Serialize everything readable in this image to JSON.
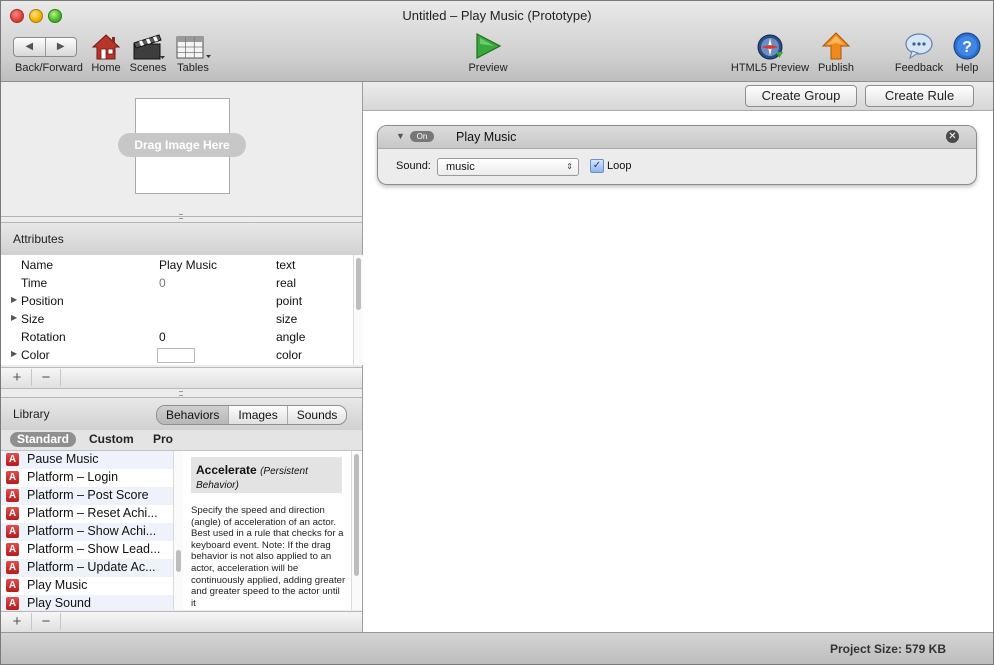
{
  "window": {
    "title": "Untitled – Play Music (Prototype)"
  },
  "toolbar": {
    "back_glyph": "◀",
    "forward_glyph": "▶",
    "back_forward_label": "Back/Forward",
    "home_label": "Home",
    "scenes_label": "Scenes",
    "tables_label": "Tables",
    "preview_label": "Preview",
    "html5_preview_label": "HTML5 Preview",
    "publish_label": "Publish",
    "feedback_label": "Feedback",
    "help_label": "Help"
  },
  "image_drop": {
    "label": "Drag Image Here"
  },
  "attributes": {
    "title": "Attributes",
    "rows": [
      {
        "name": "Name",
        "value": "Play Music",
        "type": "text",
        "expandable": false
      },
      {
        "name": "Time",
        "value": "0",
        "type": "real",
        "expandable": false
      },
      {
        "name": "Position",
        "value": "",
        "type": "point",
        "expandable": true
      },
      {
        "name": "Size",
        "value": "",
        "type": "size",
        "expandable": true
      },
      {
        "name": "Rotation",
        "value": "0",
        "type": "angle",
        "expandable": false
      },
      {
        "name": "Color",
        "value": "",
        "type": "color",
        "expandable": true
      }
    ],
    "add_label": "+",
    "remove_label": "−"
  },
  "library": {
    "title": "Library",
    "segments": [
      "Behaviors",
      "Images",
      "Sounds"
    ],
    "selected_segment": "Behaviors",
    "tabs": [
      "Standard",
      "Custom",
      "Pro"
    ],
    "selected_tab": "Standard",
    "behavior_icon_letter": "A",
    "items": [
      "Pause Music",
      "Platform – Login",
      "Platform – Post Score",
      "Platform – Reset Achi...",
      "Platform – Show Achi...",
      "Platform – Show Lead...",
      "Platform – Update Ac...",
      "Play Music",
      "Play Sound"
    ],
    "description": {
      "title": "Accelerate",
      "subtitle": "(Persistent Behavior)",
      "body": "Specify the speed and direction (angle) of acceleration of an actor. Best used in a rule that checks for a keyboard event. Note: If the drag behavior is not also applied to an actor, acceleration will be continuously applied, adding greater and greater speed to the actor until it"
    },
    "add_label": "+",
    "remove_label": "−"
  },
  "editor": {
    "create_group_label": "Create Group",
    "create_rule_label": "Create Rule",
    "behavior": {
      "on_label": "On",
      "title": "Play Music",
      "close_glyph": "✕",
      "sound_label": "Sound:",
      "sound_value": "music",
      "select_arrows": "⇕",
      "loop_checked_glyph": "✓",
      "loop_label": "Loop",
      "loop_checked": true
    }
  },
  "status": {
    "project_size": "Project Size: 579 KB"
  },
  "colors": {
    "accent_green": "#3aa83a",
    "publish_orange": "#f08a1c",
    "help_blue": "#2a6fd1",
    "behavior_red": "#c42727"
  },
  "icons": [
    "back-icon",
    "forward-icon",
    "home-icon",
    "scenes-icon",
    "tables-icon",
    "preview-icon",
    "html5-preview-icon",
    "publish-icon",
    "feedback-icon",
    "help-icon"
  ]
}
